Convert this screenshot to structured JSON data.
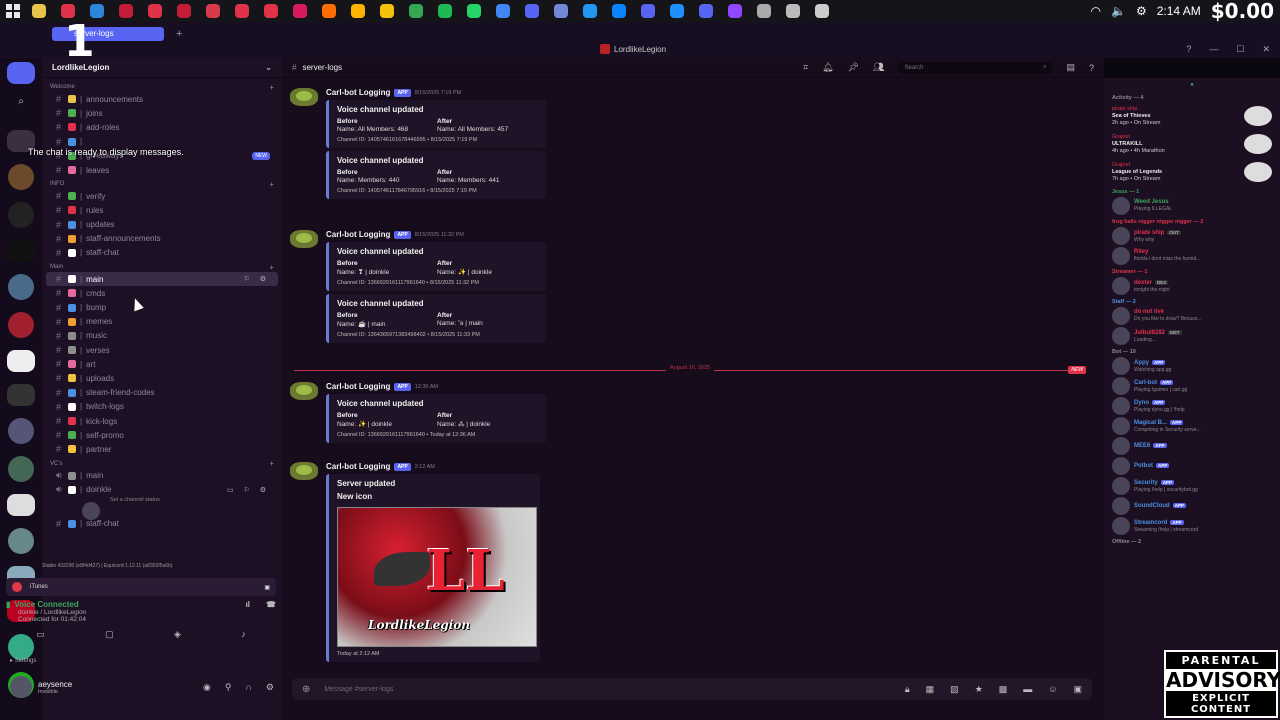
{
  "taskbar": {
    "time": "2:14 AM",
    "overlay_money": "$0.00",
    "app_colors": [
      "#e8c44a",
      "#e0334a",
      "#2b86d9",
      "#c41d3a",
      "#e0334a",
      "#c41d3a",
      "#d73a49",
      "#e0334a",
      "#e0334a",
      "#d81b60",
      "#ff6d00",
      "#ffb300",
      "#f4c20d",
      "#34a853",
      "#1db954",
      "#25d366",
      "#4285f4",
      "#5865f2",
      "#7289da",
      "#2196f3",
      "#0a84ff",
      "#5865f2",
      "#1e90ff",
      "#5865f2",
      "#9146ff",
      "#aaaaaa",
      "#bbbbbb",
      "#cccccc"
    ]
  },
  "window": {
    "title": "LordlikeLegion",
    "tab_label": "server-logs",
    "stream_number": "1"
  },
  "tooltip": "The chat is ready to display messages.",
  "server": {
    "name": "LordlikeLegion",
    "categories": [
      {
        "name": "Welcome",
        "channels": [
          {
            "label": "announcements",
            "color": "#e8c44a"
          },
          {
            "label": "joins",
            "color": "#4caf50"
          },
          {
            "label": "add-roles",
            "color": "#e0334a"
          },
          {
            "label": "",
            "color": "#4a90e2"
          },
          {
            "label": "giveaways",
            "color": "#4caf50",
            "badge": "NEW"
          },
          {
            "label": "leaves",
            "color": "#e26a9c"
          }
        ]
      },
      {
        "name": "INFO",
        "channels": [
          {
            "label": "verify",
            "color": "#4caf50"
          },
          {
            "label": "rules",
            "color": "#e0334a"
          },
          {
            "label": "updates",
            "color": "#4a90e2"
          },
          {
            "label": "staff-announcements",
            "color": "#f0a030"
          },
          {
            "label": "staff-chat",
            "color": "#ffffff"
          }
        ]
      },
      {
        "name": "Main",
        "channels": [
          {
            "label": "main",
            "color": "#ffffff",
            "active": true
          },
          {
            "label": "cmds",
            "color": "#e26a9c"
          },
          {
            "label": "bump",
            "color": "#4a90e2"
          },
          {
            "label": "memes",
            "color": "#f0a030"
          },
          {
            "label": "music",
            "color": "#8e8e8e"
          },
          {
            "label": "verses",
            "color": "#8e8e8e"
          },
          {
            "label": "art",
            "color": "#e26a9c"
          },
          {
            "label": "uploads",
            "color": "#f0c040"
          },
          {
            "label": "steam-friend-codes",
            "color": "#4a90e2"
          },
          {
            "label": "twitch-logs",
            "color": "#ffffff"
          },
          {
            "label": "kick-logs",
            "color": "#e0334a"
          },
          {
            "label": "self-promo",
            "color": "#4caf50"
          },
          {
            "label": "partner",
            "color": "#f0c040"
          }
        ]
      },
      {
        "name": "VC's",
        "channels": [
          {
            "label": "main",
            "color": "#8e8e8e"
          },
          {
            "label": "doinkle",
            "color": "#ffffff"
          }
        ]
      }
    ],
    "voice_user_status": "Set a channel status",
    "extra_channel": "staff-chat"
  },
  "stats_line": "Stable 432290 (e8f4d427) | Equicord 1.12.11 (a8301f5a6b)",
  "now_playing": "iTunes",
  "voice": {
    "status": "Voice Connected",
    "channel": "doinkle / LordlikeLegion",
    "duration": "Connected for 01:42:04"
  },
  "settings_label": "Settings",
  "user": {
    "name": "aeysence",
    "status": "Invisible"
  },
  "chat": {
    "channel": "server-logs",
    "search_placeholder": "Search",
    "composer_placeholder": "Message #server-logs",
    "date_divider": "August 16, 2025",
    "new_label": "NEW",
    "messages": [
      {
        "author": "Carl-bot Logging",
        "tag": "APP",
        "time": "8/15/2025 7:19 PM",
        "embeds": [
          {
            "title": "Voice channel updated",
            "before_label": "Before",
            "after_label": "After",
            "before": "Name: All Members: 468",
            "after": "Name: All Members: 457",
            "footer": "Channel ID: 1405746161678446995 • 8/15/2025 7:19 PM"
          },
          {
            "title": "Voice channel updated",
            "before_label": "Before",
            "after_label": "After",
            "before": "Name: Members: 440",
            "after": "Name: Members: 441",
            "footer": "Channel ID: 1405746117846795916 • 8/15/2025 7:19 PM"
          }
        ]
      },
      {
        "author": "Carl-bot Logging",
        "tag": "APP",
        "time": "8/15/2025 11:32 PM",
        "embeds": [
          {
            "title": "Voice channel updated",
            "before_label": "Before",
            "after_label": "After",
            "before": "Name: ❣ | doinkle",
            "after": "Name: ✨ | doinkle",
            "footer": "Channel ID: 1366929161117961640 • 8/15/2025 11:32 PM"
          },
          {
            "title": "Voice channel updated",
            "before_label": "Before",
            "after_label": "After",
            "before": "Name: ☕ | main",
            "after": "Name: ˚ʚ | main",
            "footer": "Channel ID: 1364365971383498402 • 8/15/2025 11:33 PM"
          }
        ]
      },
      {
        "author": "Carl-bot Logging",
        "tag": "APP",
        "time": "12:36 AM",
        "embeds": [
          {
            "title": "Voice channel updated",
            "before_label": "Before",
            "after_label": "After",
            "before": "Name: ✨ | doinkle",
            "after": "Name: ⁂ | doinkle",
            "footer": "Channel ID: 1366929161117961640 • Today at 12:36 AM"
          }
        ]
      },
      {
        "author": "Carl-bot Logging",
        "tag": "APP",
        "time": "2:12 AM",
        "server_update": {
          "title": "Server updated",
          "subtitle": "New icon",
          "image_caption": "LordlikeLegion",
          "footer": "Today at 2:12 AM"
        }
      }
    ]
  },
  "members": {
    "activity_header": "Activity — 4",
    "activities": [
      {
        "who": "pirate ship",
        "game": "Sea of Thieves",
        "meta": "2h ago • On Stream"
      },
      {
        "who": "Grajnet",
        "game": "ULTRAKILL",
        "meta": "4h ago • 4h Marathon"
      },
      {
        "who": "Grajnet",
        "game": "League of Legends",
        "meta": "7h ago • On Stream"
      }
    ],
    "groups": [
      {
        "name": "Jesus — 1",
        "style": "green",
        "members": [
          {
            "name": "Weed Jesus",
            "sub": "Playing ILLEGAL",
            "color": "#3ba55d"
          }
        ]
      },
      {
        "name": "frog balls nigger nigger nigger — 2",
        "style": "red",
        "members": [
          {
            "name": "pirate ship",
            "sub": "Why why",
            "color": "#e0334a",
            "tag": "OUT"
          },
          {
            "name": "Riley",
            "sub": "florida i dont miss the humid...",
            "color": "#e0334a"
          }
        ]
      },
      {
        "name": "Streamer — 1",
        "style": "red",
        "members": [
          {
            "name": "dexter",
            "sub": "tonight the night",
            "color": "#e0334a",
            "tag": "DEX"
          }
        ]
      },
      {
        "name": "Staff — 2",
        "style": "blue",
        "members": [
          {
            "name": "do not live",
            "sub": "Do you like to draw? Becaus...",
            "color": "#e0334a"
          },
          {
            "name": "Julbul8282",
            "sub": "Loading...",
            "color": "#e0334a",
            "tag": "MST"
          }
        ]
      },
      {
        "name": "Bot — 10",
        "style": "",
        "members": [
          {
            "name": "Appy",
            "sub": "Watching app.gg",
            "color": "#4a90e2",
            "bot": "APP"
          },
          {
            "name": "Carl-bot",
            "sub": "Playing /games | carl.gg",
            "color": "#4a90e2",
            "bot": "APP"
          },
          {
            "name": "Dyno",
            "sub": "Playing dyno.gg | !help",
            "color": "#4a90e2",
            "bot": "APP"
          },
          {
            "name": "Magical B...",
            "sub": "Competing in Security serve...",
            "color": "#4a90e2",
            "bot": "APP"
          },
          {
            "name": "MEE6",
            "sub": "",
            "color": "#4a90e2",
            "bot": "APP"
          },
          {
            "name": "Potbot",
            "sub": "",
            "color": "#4a90e2",
            "bot": "APP"
          },
          {
            "name": "Security",
            "sub": "Playing /help | securitybot.gg",
            "color": "#4a90e2",
            "bot": "APP"
          },
          {
            "name": "SoundCloud",
            "sub": "",
            "color": "#4a90e2",
            "bot": "APP"
          },
          {
            "name": "Streamcord",
            "sub": "Streaming /help | streamcord",
            "color": "#4a90e2",
            "bot": "APP"
          }
        ]
      },
      {
        "name": "Offline — 2",
        "style": "",
        "members": []
      }
    ]
  },
  "advisory": {
    "top": "PARENTAL",
    "mid": "ADVISORY",
    "bot": "EXPLICIT CONTENT"
  }
}
